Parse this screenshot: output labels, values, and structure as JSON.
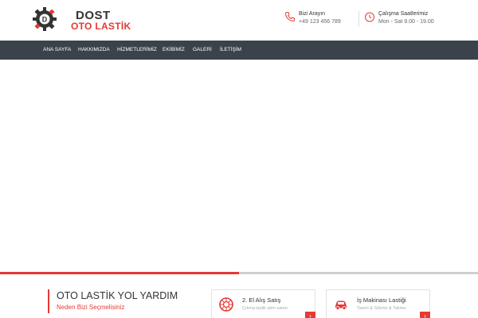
{
  "brand": {
    "name_line1": "DOST",
    "name_line2": "OTO LASTİK",
    "logo_letter": "D",
    "colors": {
      "accent": "#e53935",
      "dark": "#333333",
      "nav_bg": "#3a434c"
    }
  },
  "header": {
    "call": {
      "icon": "phone-icon",
      "title": "Bizi Arayın",
      "value": "+49 123 456 789"
    },
    "hours": {
      "icon": "clock-icon",
      "title": "Çalışma Saatlerimiz",
      "value": "Mon - Sat 9.00 - 19.00"
    }
  },
  "nav": {
    "items": [
      {
        "label": "ANA SAYFA"
      },
      {
        "label": "HAKKIMIZDA"
      },
      {
        "label": "HİZMETLERİMİZ"
      },
      {
        "label": "EKİBİMİZ"
      },
      {
        "label": "GALERİ"
      },
      {
        "label": "İLETİŞİM"
      }
    ]
  },
  "slider": {
    "progress": 0.5
  },
  "section": {
    "title": "OTO LASTİK YOL YARDIM",
    "subtitle": "Neden Bizi Seçmelisiniz"
  },
  "cards": [
    {
      "icon": "tire-icon",
      "title": "2. El Alış Satış",
      "subtitle": "Çıkma lastik alım satım",
      "arrow": "›"
    },
    {
      "icon": "car-icon",
      "title": "İş Makinası Lastiği",
      "subtitle": "Tamiri & Sökme & Takma",
      "arrow": "›"
    }
  ]
}
